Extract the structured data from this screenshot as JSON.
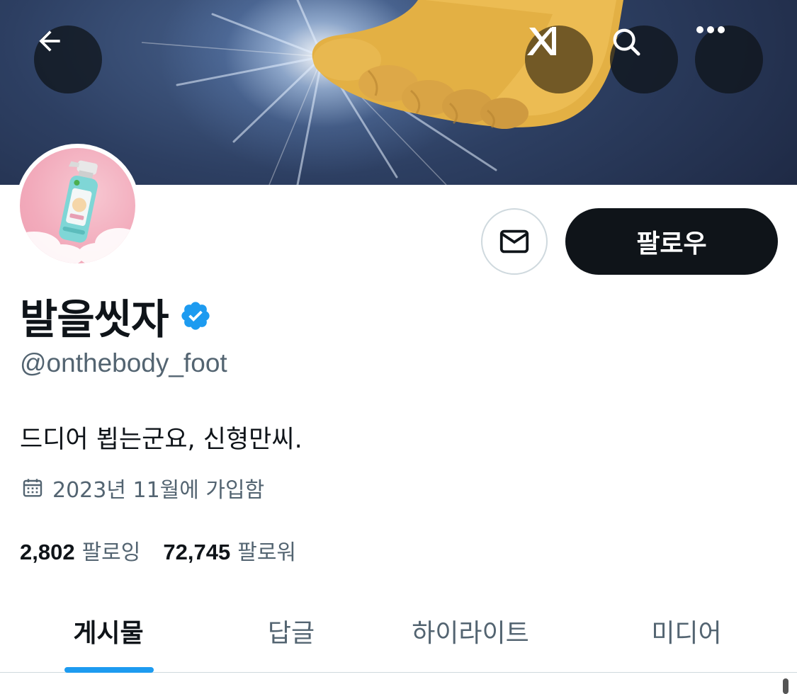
{
  "header": {
    "back_icon": "arrow-left-icon",
    "grok_icon": "grok-logo-icon",
    "search_icon": "search-icon",
    "more_icon": "more-horizontal-icon"
  },
  "profile": {
    "display_name": "발을씻자",
    "verified": true,
    "handle": "@onthebody_foot",
    "bio": "드디어 뵙는군요, 신형만씨.",
    "joined": "2023년 11월에 가입함",
    "following_count": "2,802",
    "following_label": "팔로잉",
    "followers_count": "72,745",
    "followers_label": "팔로워"
  },
  "actions": {
    "message_icon": "envelope-icon",
    "follow_label": "팔로우"
  },
  "tabs": [
    {
      "label": "게시물",
      "active": true
    },
    {
      "label": "답글",
      "active": false
    },
    {
      "label": "하이라이트",
      "active": false
    },
    {
      "label": "미디어",
      "active": false
    }
  ],
  "colors": {
    "accent": "#1d9bf0",
    "text_primary": "#0f1419",
    "text_secondary": "#536471",
    "verified_badge": "#1d9bf0"
  }
}
